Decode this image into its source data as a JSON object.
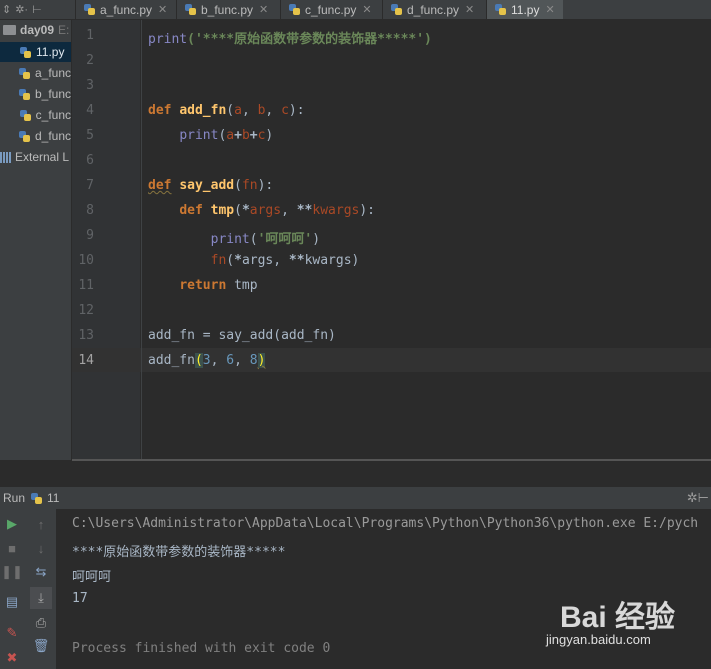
{
  "toolbar_icons": [
    "sync-icon",
    "gear-icon",
    "collapse-icon"
  ],
  "tabs": [
    {
      "label": "a_func.py",
      "active": false
    },
    {
      "label": "b_func.py",
      "active": false
    },
    {
      "label": "c_func.py",
      "active": false
    },
    {
      "label": "d_func.py",
      "active": false
    },
    {
      "label": "11.py",
      "active": true
    }
  ],
  "project": {
    "root_label": "day09",
    "root_suffix": "E:",
    "files": [
      "11.py",
      "a_func",
      "b_func",
      "c_func",
      "d_func"
    ],
    "external": "External L"
  },
  "editor": {
    "line_numbers": [
      "1",
      "2",
      "3",
      "4",
      "5",
      "6",
      "7",
      "8",
      "9",
      "10",
      "11",
      "12",
      "13",
      "14"
    ],
    "line1_print": "print",
    "line1_string": "('****原始函数带参数的装饰器*****')",
    "line4_def": "def",
    "line4_name": "add_fn",
    "line4_params": [
      "a",
      "b",
      "c"
    ],
    "line5_print": "print",
    "line5_expr": [
      "a",
      "b",
      "c"
    ],
    "line7_name": "say_add",
    "line7_param": "fn",
    "line8_name": "tmp",
    "line8_args": "args",
    "line8_kwargs": "kwargs",
    "line9_print": "print",
    "line9_string": "'呵呵呵'",
    "line10_call": "fn",
    "line11_return": "return",
    "line11_value": "tmp",
    "line13_target": "add_fn",
    "line13_call": "say_add",
    "line13_arg": "add_fn",
    "line14_call": "add_fn",
    "line14_args": [
      "3",
      "6",
      "8"
    ]
  },
  "run": {
    "title": "Run",
    "config": "11",
    "command": "C:\\Users\\Administrator\\AppData\\Local\\Programs\\Python\\Python36\\python.exe E:/pych",
    "output": [
      "****原始函数带参数的装饰器*****",
      "呵呵呵",
      "17"
    ],
    "exit": "Process finished with exit code 0"
  },
  "watermark": {
    "logo": "Bai 经验",
    "url": "jingyan.baidu.com"
  },
  "colors": {
    "keyword": "#cc7832",
    "function": "#ffc66d",
    "string": "#6a8759",
    "number": "#6897bb",
    "parameter": "#aa4926",
    "builtin": "#8888c6"
  }
}
